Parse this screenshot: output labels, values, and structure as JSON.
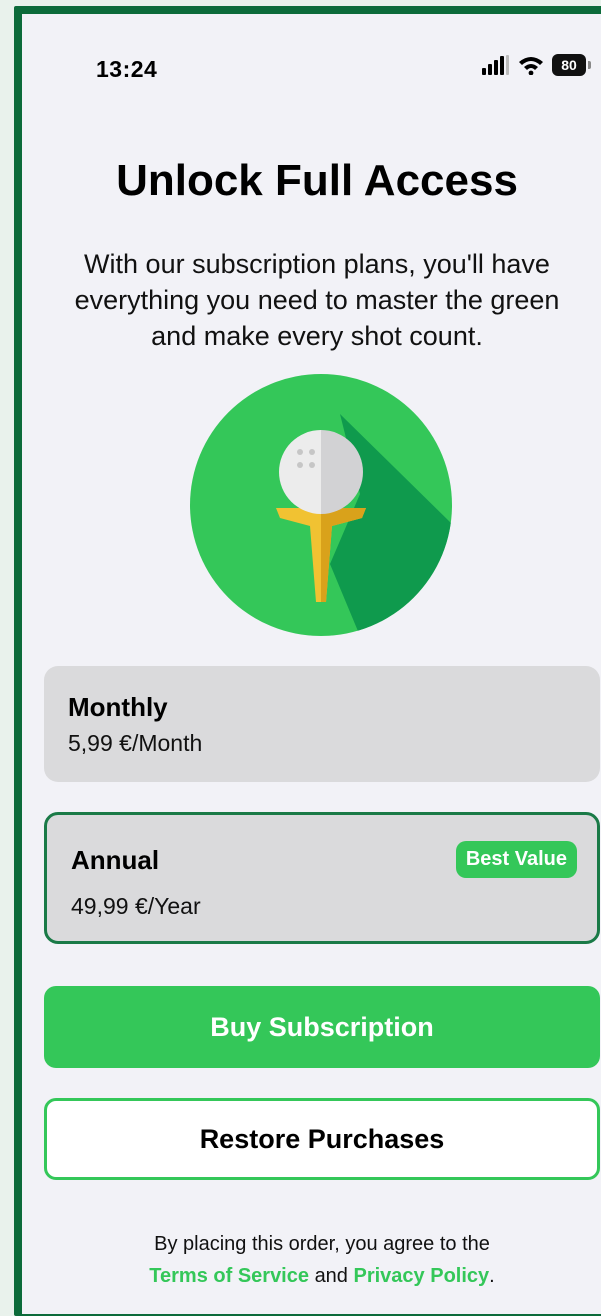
{
  "status_bar": {
    "time": "13:24",
    "battery_level": "80",
    "icons": [
      "signal-icon",
      "wifi-icon",
      "battery-icon"
    ]
  },
  "header": {
    "title": "Unlock Full Access",
    "subtitle": "With our subscription plans, you'll have everything you need to master the green and make every shot count."
  },
  "hero": {
    "icon": "golf-ball-on-tee-icon"
  },
  "plans": [
    {
      "name": "Monthly",
      "price": "5,99 €/Month",
      "selected": false
    },
    {
      "name": "Annual",
      "price": "49,99 €/Year",
      "badge": "Best Value",
      "selected": true
    }
  ],
  "actions": {
    "buy_label": "Buy Subscription",
    "restore_label": "Restore Purchases"
  },
  "legal": {
    "prefix": "By placing this order, you agree to the",
    "terms_label": "Terms of Service",
    "and": "and",
    "privacy_label": "Privacy Policy",
    "suffix": "."
  },
  "colors": {
    "accent": "#34c759",
    "frame": "#0c6b3a",
    "background": "#f2f2f7",
    "card": "#dadadc"
  }
}
